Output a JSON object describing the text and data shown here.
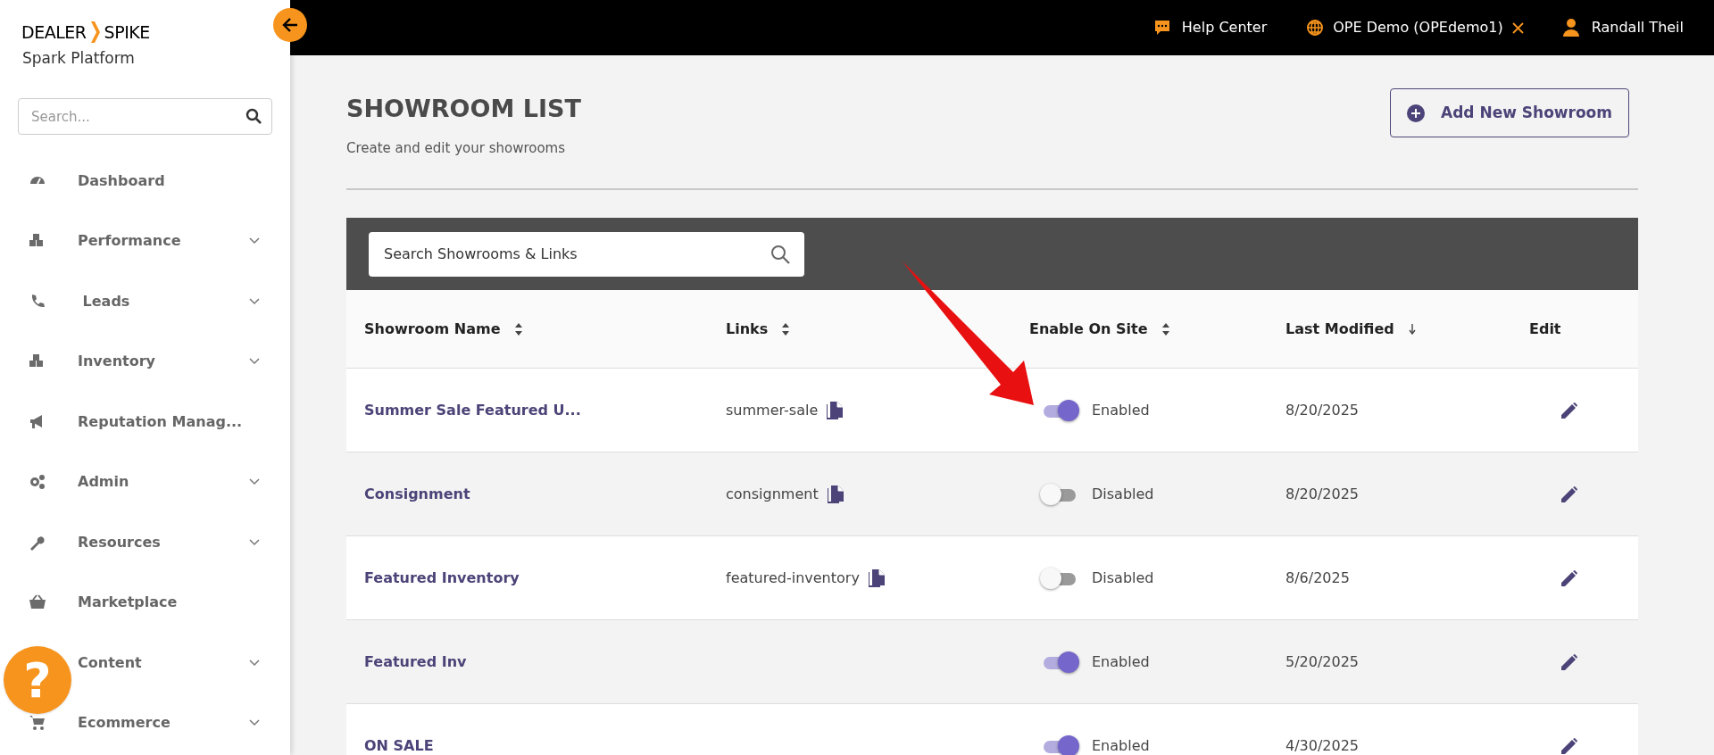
{
  "brand": {
    "logo_left": "DEALER",
    "logo_right": "SPIKE",
    "subtitle": "Spark Platform"
  },
  "sidebar": {
    "search": {
      "placeholder": "Search..."
    },
    "items": [
      {
        "label": "Dashboard",
        "expandable": false
      },
      {
        "label": "Performance",
        "expandable": true
      },
      {
        "label": " Leads",
        "expandable": true
      },
      {
        "label": "Inventory",
        "expandable": true
      },
      {
        "label": "Reputation Manag...",
        "expandable": false
      },
      {
        "label": "Admin",
        "expandable": true
      },
      {
        "label": "Resources",
        "expandable": true
      },
      {
        "label": "Marketplace",
        "expandable": false
      },
      {
        "label": "Content",
        "expandable": true
      },
      {
        "label": "Ecommerce",
        "expandable": true
      }
    ]
  },
  "top_bar": {
    "help": "Help Center",
    "site": "OPE Demo (OPEdemo1)",
    "user": "Randall Theil"
  },
  "page": {
    "title": "SHOWROOM LIST",
    "subtitle": "Create and edit your showrooms",
    "add_button": "Add New Showroom"
  },
  "table": {
    "search": {
      "placeholder": "Search Showrooms & Links"
    },
    "columns": [
      {
        "label": "Showroom Name",
        "kind": "sortable"
      },
      {
        "label": "Links",
        "kind": "sortable"
      },
      {
        "label": "Enable On Site",
        "kind": "sortable"
      },
      {
        "label": "Last Modified",
        "kind": "sorted"
      },
      {
        "label": "Edit",
        "kind": "plain"
      }
    ],
    "rows": [
      {
        "name": "Summer Sale Featured U...",
        "link": "summer-sale",
        "on": true,
        "status": "Enabled",
        "modified": "8/20/2025"
      },
      {
        "name": "Consignment",
        "link": "consignment",
        "on": false,
        "status": "Disabled",
        "modified": "8/20/2025"
      },
      {
        "name": "Featured Inventory",
        "link": "featured-inventory",
        "on": false,
        "status": "Disabled",
        "modified": "8/6/2025"
      },
      {
        "name": "Featured Inv",
        "on": true,
        "status": "Enabled",
        "modified": "5/20/2025"
      },
      {
        "name": "ON SALE",
        "on": true,
        "status": "Enabled",
        "modified": "4/30/2025"
      }
    ]
  },
  "help_bubble": {
    "label": "?"
  }
}
